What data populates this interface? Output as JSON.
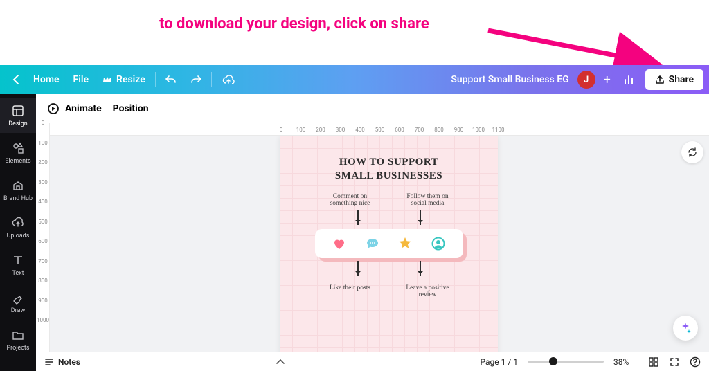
{
  "annotation": {
    "text": "to download your design, click on share"
  },
  "topbar": {
    "home": "Home",
    "file": "File",
    "resize": "Resize",
    "doc_title": "Support Small Business EG",
    "avatar_initial": "J",
    "share": "Share"
  },
  "toolbar": {
    "animate": "Animate",
    "position": "Position"
  },
  "rail": {
    "items": [
      {
        "key": "design",
        "label": "Design"
      },
      {
        "key": "elements",
        "label": "Elements"
      },
      {
        "key": "brandhub",
        "label": "Brand Hub"
      },
      {
        "key": "uploads",
        "label": "Uploads"
      },
      {
        "key": "text",
        "label": "Text"
      },
      {
        "key": "draw",
        "label": "Draw"
      },
      {
        "key": "projects",
        "label": "Projects"
      }
    ]
  },
  "rulers": {
    "h": [
      "0",
      "100",
      "200",
      "300",
      "400",
      "500",
      "600",
      "700",
      "800",
      "900",
      "1000",
      "1100"
    ],
    "v": [
      "0",
      "100",
      "200",
      "300",
      "400",
      "500",
      "600",
      "700",
      "800",
      "900",
      "1000"
    ]
  },
  "design": {
    "title_line1": "HOW TO SUPPORT",
    "title_line2": "SMALL BUSINESSES",
    "tip_comment": "Comment on something nice",
    "tip_follow": "Follow them on social media",
    "tip_like": "Like their posts",
    "tip_review": "Leave a positive review"
  },
  "bottombar": {
    "notes": "Notes",
    "page": "Page 1 / 1",
    "zoom_percent": "38%",
    "zoom_position_pct": 32
  }
}
